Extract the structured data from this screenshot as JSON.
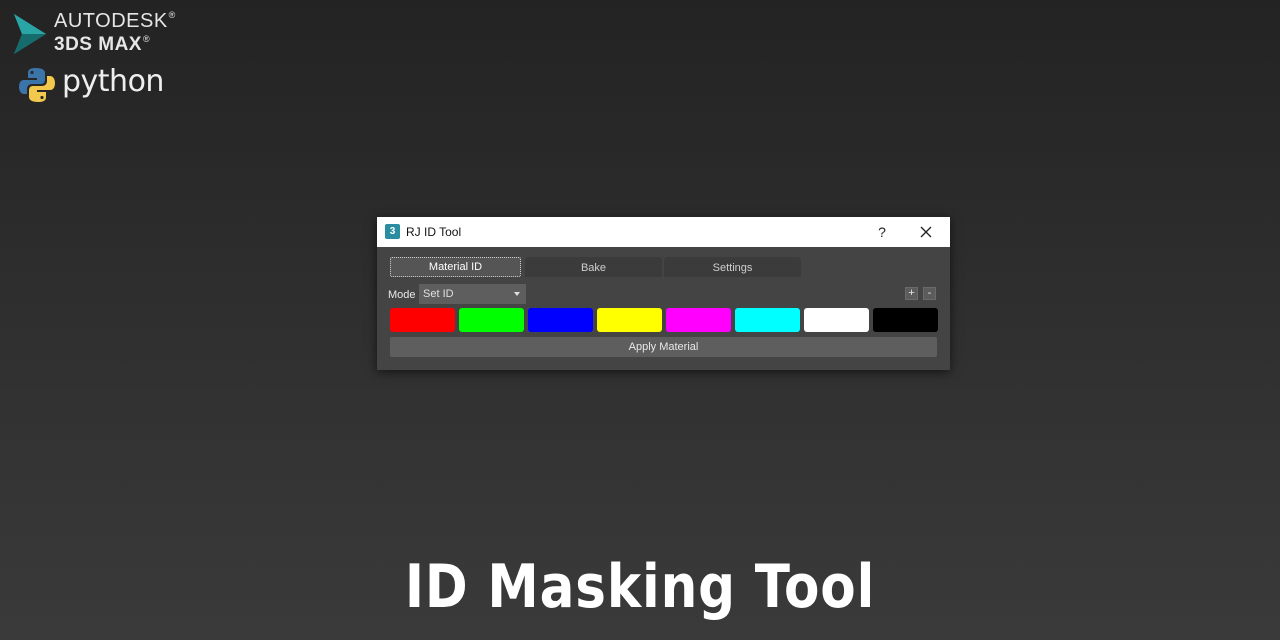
{
  "branding": {
    "autodesk_line1": "AUTODESK",
    "autodesk_line2": "3DS MAX",
    "registered_mark": "®",
    "python_word": "python"
  },
  "window": {
    "title": "RJ ID Tool",
    "icon_text": "3",
    "help_label": "?",
    "close_icon": "close-icon",
    "tabs": [
      {
        "label": "Material ID",
        "active": true
      },
      {
        "label": "Bake",
        "active": false
      },
      {
        "label": "Settings",
        "active": false
      }
    ],
    "mode_label": "Mode",
    "mode_value": "Set ID",
    "add_label": "+",
    "remove_label": "-",
    "swatches": [
      {
        "color": "#ff0000"
      },
      {
        "color": "#00ff00"
      },
      {
        "color": "#0000ff"
      },
      {
        "color": "#ffff00"
      },
      {
        "color": "#ff00ff"
      },
      {
        "color": "#00ffff"
      },
      {
        "color": "#ffffff"
      },
      {
        "color": "#000000"
      }
    ],
    "apply_label": "Apply Material"
  },
  "headline": "ID Masking Tool",
  "colors": {
    "window_bg": "#444444",
    "titlebar_bg": "#ffffff",
    "button_bg": "#5e5e5e",
    "python_blue": "#3b74a8",
    "python_yellow": "#f2c94c",
    "max_teal": "#1f8a8a"
  }
}
